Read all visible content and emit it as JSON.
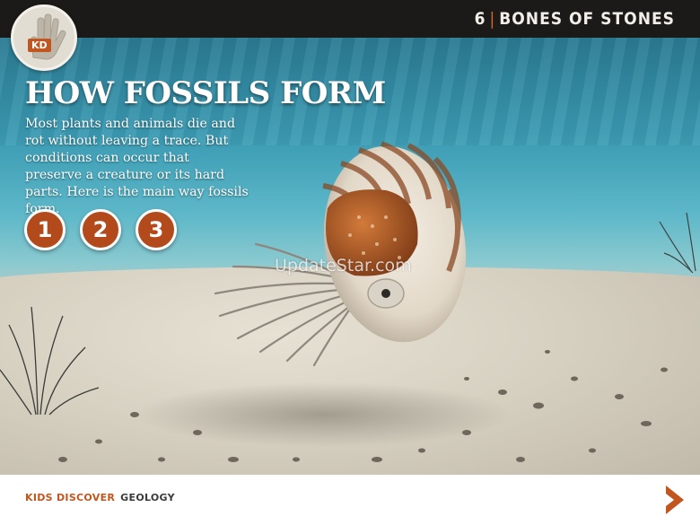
{
  "header": {
    "page_number": "6",
    "section_title": "BONES OF STONES",
    "logo_text": "KD"
  },
  "main": {
    "title": "HOW FOSSILS FORM",
    "intro": "Most plants and animals die and rot without leaving a trace. But conditions can occur that preserve a creature or its hard parts. Here is the main way fossils form.",
    "steps": [
      {
        "label": "1"
      },
      {
        "label": "2"
      },
      {
        "label": "3"
      }
    ],
    "watermark": "UpdateStar.com"
  },
  "footer": {
    "brand": "KIDS DISCOVER",
    "subject": "GEOLOGY",
    "next_icon": "chevron-right-icon"
  },
  "colors": {
    "accent": "#c2561f",
    "step_fill": "#b34a1c",
    "topbar": "#1b1a19"
  }
}
